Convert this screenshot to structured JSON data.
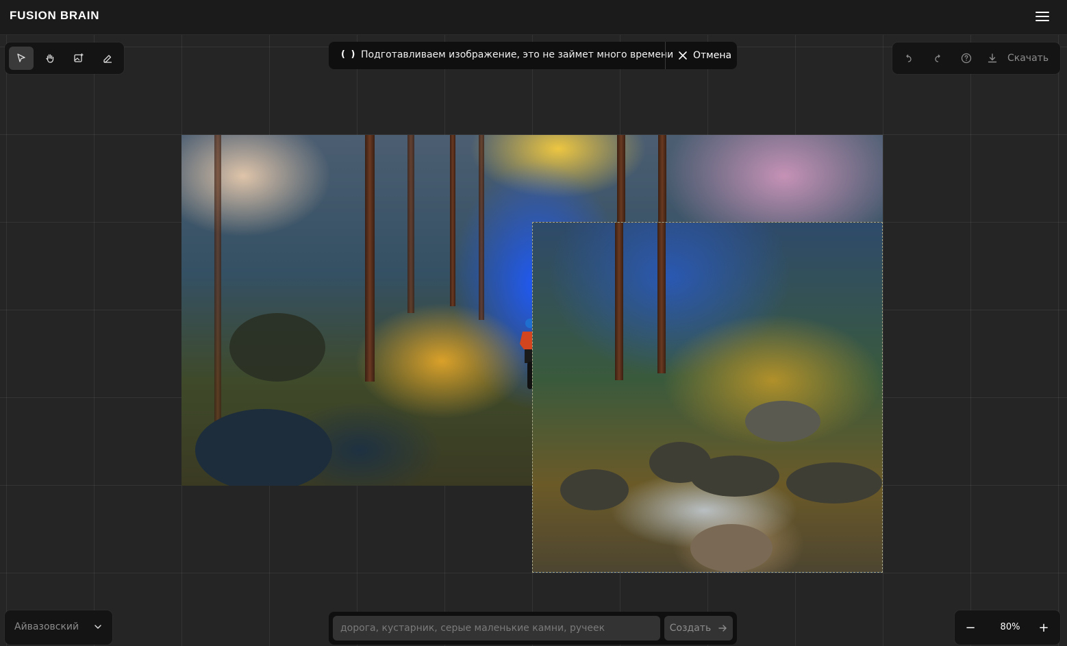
{
  "app": {
    "title": "FUSION BRAIN"
  },
  "header": {
    "menu_icon": "hamburger-menu-icon"
  },
  "toolbar": {
    "tools": [
      {
        "icon": "cursor-icon",
        "active": true
      },
      {
        "icon": "hand-icon",
        "active": false
      },
      {
        "icon": "add-image-icon",
        "active": false
      },
      {
        "icon": "eraser-icon",
        "active": false
      }
    ]
  },
  "status": {
    "spinner": "( )",
    "message": "Подготавливаем изображение, это не займет много времени",
    "cancel_label": "Отмена"
  },
  "actions": {
    "undo_icon": "undo-icon",
    "redo_icon": "redo-icon",
    "help_icon": "help-icon",
    "download_label": "Скачать"
  },
  "style_select": {
    "value": "Айвазовский"
  },
  "prompt": {
    "placeholder": "дорога, кустарник, серые маленькие камни, ручеек",
    "value": "",
    "create_label": "Создать"
  },
  "zoom": {
    "minus": "−",
    "level": "80%",
    "plus": "+"
  },
  "colors": {
    "background": "#252525",
    "panel": "#141414",
    "topbar": "#1b1b1b",
    "accent_text": "#ffffff",
    "muted_text": "#8c8c8c"
  }
}
